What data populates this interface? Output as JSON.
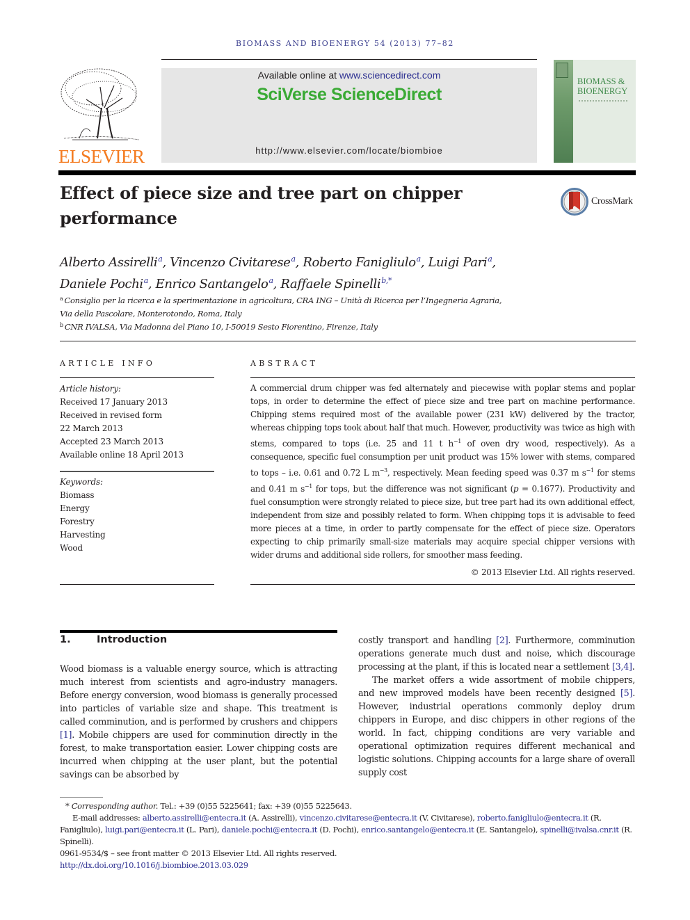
{
  "running_head": "BIOMASS AND BIOENERGY 54 (2013) 77–82",
  "publisher": {
    "name": "ELSEVIER",
    "logo_icon": "elsevier-tree-icon",
    "color": "#f47b20"
  },
  "banner": {
    "available_prefix": "Available online at ",
    "available_link": "www.sciencedirect.com",
    "brand": "SciVerse ScienceDirect",
    "brand_color": "#3aaa35",
    "journal_url": "http://www.elsevier.com/locate/biombioe"
  },
  "journal_cover": {
    "title_line1": "BIOMASS &",
    "title_line2": "BIOENERGY",
    "color": "#3f8a4a"
  },
  "article": {
    "title": "Effect of piece size and tree part on chipper performance",
    "crossmark_label": "CrossMark",
    "authors": [
      {
        "name": "Alberto Assirelli",
        "affil": "a"
      },
      {
        "name": "Vincenzo Civitarese",
        "affil": "a"
      },
      {
        "name": "Roberto Fanigliulo",
        "affil": "a"
      },
      {
        "name": "Luigi Pari",
        "affil": "a"
      },
      {
        "name": "Daniele Pochi",
        "affil": "a"
      },
      {
        "name": "Enrico Santangelo",
        "affil": "a"
      },
      {
        "name": "Raffaele Spinelli",
        "affil": "b,*"
      }
    ],
    "affiliations": [
      {
        "mark": "a",
        "line1": "Consiglio per la ricerca e la sperimentazione in agricoltura, CRA ING – Unità di Ricerca per l’Ingegneria Agraria,",
        "line2": "Via della Pascolare, Monterotondo, Roma, Italy"
      },
      {
        "mark": "b",
        "line1": "CNR IVALSA, Via Madonna del Piano 10, I-50019 Sesto Fiorentino, Firenze, Italy"
      }
    ]
  },
  "article_info": {
    "heading": "ARTICLE INFO",
    "history_label": "Article history:",
    "history": [
      "Received 17 January 2013",
      "Received in revised form",
      "22 March 2013",
      "Accepted 23 March 2013",
      "Available online 18 April 2013"
    ],
    "keywords_label": "Keywords:",
    "keywords": [
      "Biomass",
      "Energy",
      "Forestry",
      "Harvesting",
      "Wood"
    ]
  },
  "abstract": {
    "heading": "ABSTRACT",
    "p1": "A commercial drum chipper was fed alternately and piecewise with poplar stems and poplar tops, in order to determine the effect of piece size and tree part on machine performance. Chipping stems required most of the available power (231 kW) delivered by the tractor, whereas chipping tops took about half that much. However, productivity was twice as high with stems, compared to tops (i.e. 25 and 11 t h",
    "sup1": "−1",
    "p2": " of oven dry wood, respectively). As a consequence, specific fuel consumption per unit product was 15% lower with stems, compared to tops – i.e. 0.61 and 0.72 L m",
    "sup2": "−3",
    "p3": ", respectively. Mean feeding speed was 0.37 m s",
    "sup3": "−1",
    "p4": " for stems and 0.41 m s",
    "sup4": "−1",
    "p5": " for tops, but the difference was not significant (",
    "p_var": "p",
    "p6": " = 0.1677). Productivity and fuel consumption were strongly related to piece size, but tree part had its own additional effect, independent from size and possibly related to form. When chipping tops it is advisable to feed more pieces at a time, in order to partly compensate for the effect of piece size. Operators expecting to chip primarily small-size materials may acquire special chipper versions with wider drums and additional side rollers, for smoother mass feeding.",
    "copyright": "© 2013 Elsevier Ltd. All rights reserved."
  },
  "introduction": {
    "number": "1.",
    "heading": "Introduction",
    "left_a": "Wood biomass is a valuable energy source, which is attracting much interest from scientists and agro-industry managers. Before energy conversion, wood biomass is generally processed into particles of variable size and shape. This treatment is called comminution, and is performed by crushers and chippers ",
    "ref1": "[1]",
    "left_b": ". Mobile chippers are used for comminution directly in the forest, to make transportation easier. Lower chipping costs are incurred when chipping at the user plant, but the potential savings can be absorbed by",
    "right_a": "costly transport and handling ",
    "ref2": "[2]",
    "right_b": ". Furthermore, comminution operations generate much dust and noise, which discourage processing at the plant, if this is located near a settlement ",
    "ref34": "[3,4]",
    "right_c": ".",
    "right_p2a": "The market offers a wide assortment of mobile chippers, and new improved models have been recently designed ",
    "ref5": "[5]",
    "right_p2b": ". However, industrial operations commonly deploy drum chippers in Europe, and disc chippers in other regions of the world. In fact, chipping conditions are very variable and operational optimization requires different mechanical and logistic solutions. Chipping accounts for a large share of overall supply cost"
  },
  "footnotes": {
    "star": "*",
    "corr_label": "Corresponding author.",
    "corr_contact": " Tel.: +39 (0)55 5225641; fax: +39 (0)55 5225643.",
    "email_label": "E-mail addresses: ",
    "emails": [
      {
        "email": "alberto.assirelli@entecra.it",
        "who": " (A. Assirelli), "
      },
      {
        "email": "vincenzo.civitarese@entecra.it",
        "who": " (V. Civitarese), "
      },
      {
        "email": "roberto.fanigliulo@entecra.it",
        "who": " (R. Fanigliulo), "
      },
      {
        "email": "luigi.pari@entecra.it",
        "who": " (L. Pari), "
      },
      {
        "email": "daniele.pochi@entecra.it",
        "who": " (D. Pochi), "
      },
      {
        "email": "enrico.santangelo@entecra.it",
        "who": " (E. Santangelo), "
      },
      {
        "email": "spinelli@ivalsa.cnr.it",
        "who": " (R. Spinelli)."
      }
    ],
    "issn_line": "0961-9534/$ – see front matter © 2013 Elsevier Ltd. All rights reserved.",
    "doi": "http://dx.doi.org/10.1016/j.biombioe.2013.03.029"
  }
}
